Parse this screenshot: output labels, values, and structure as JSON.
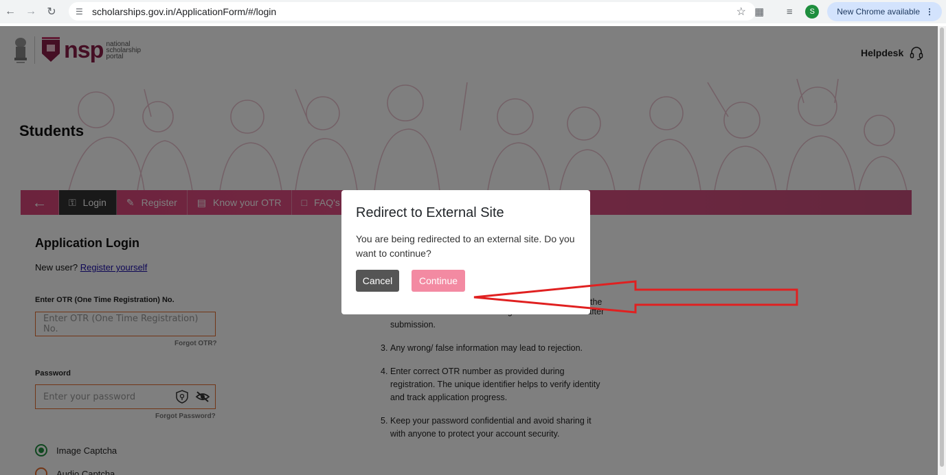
{
  "browser": {
    "url": "scholarships.gov.in/ApplicationForm/#/login",
    "profile_initial": "S",
    "update_label": "New Chrome available"
  },
  "header": {
    "logo_brand": "nsp",
    "logo_sub_line1": "national",
    "logo_sub_line2": "scholarship",
    "logo_sub_line3": "portal",
    "helpdesk_label": "Helpdesk"
  },
  "hero": {
    "title": "Students"
  },
  "tabs": [
    {
      "label": "Login",
      "active": true
    },
    {
      "label": "Register",
      "active": false
    },
    {
      "label": "Know your OTR",
      "active": false
    },
    {
      "label": "FAQ's",
      "active": false
    }
  ],
  "login": {
    "title": "Application Login",
    "new_user_prefix": "New user?",
    "register_link": "Register yourself",
    "otr_label": "Enter OTR (One Time Registration) No.",
    "otr_placeholder": "Enter OTR (One Time Registration) No.",
    "forgot_otr": "Forgot OTR?",
    "password_label": "Password",
    "password_placeholder": "Enter your password",
    "forgot_password": "Forgot Password?",
    "captcha_options": [
      {
        "label": "Image Captcha",
        "selected": true
      },
      {
        "label": "Audio Captcha",
        "selected": false
      }
    ]
  },
  "instructions": [
    {
      "num": "",
      "text": "required details carefully and check properly before submission as correction/editing will not be allowed after submission."
    },
    {
      "num": "3.",
      "text": "Any wrong/ false information may lead to rejection."
    },
    {
      "num": "4.",
      "text": "Enter correct OTR number as provided during registration. The unique identifier helps to verify identity and track application progress."
    },
    {
      "num": "5.",
      "text": "Keep your password confidential and avoid sharing it with anyone to protect your account security."
    }
  ],
  "instructions_partial_tail": "the",
  "modal": {
    "title": "Redirect to External Site",
    "body": "You are being redirected to an external site. Do you want to continue?",
    "cancel_label": "Cancel",
    "continue_label": "Continue"
  },
  "colors": {
    "tab_bar": "#e44f85",
    "continue_button": "#f38aa2",
    "cancel_button": "#555555",
    "annotation_arrow": "#e02020"
  }
}
